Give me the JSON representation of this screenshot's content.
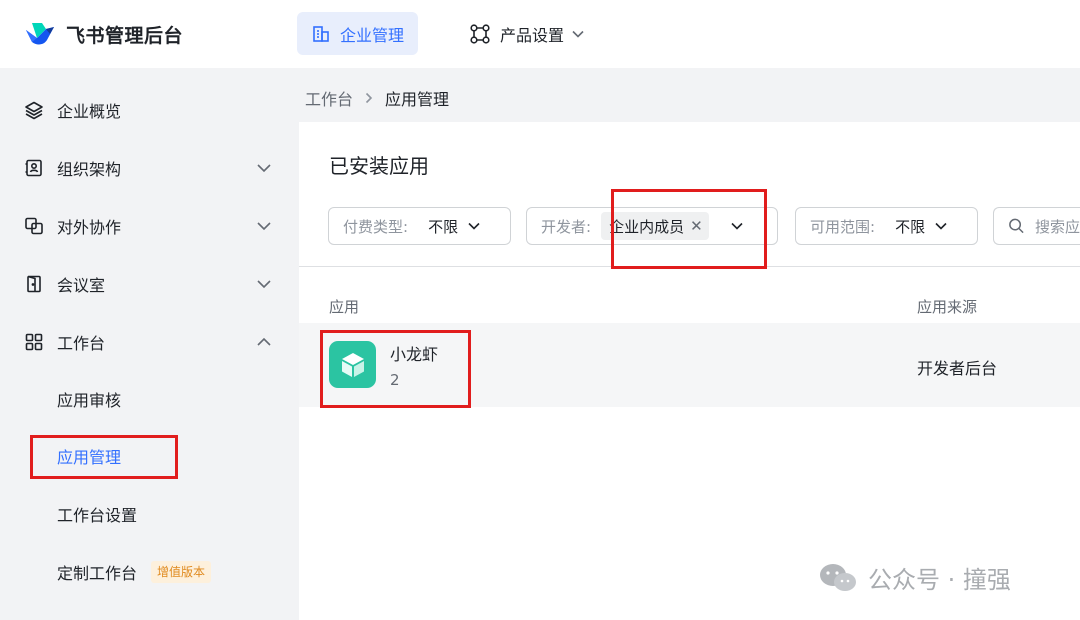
{
  "header": {
    "brand": "飞书管理后台",
    "nav": [
      {
        "label": "企业管理",
        "active": true
      },
      {
        "label": "产品设置",
        "active": false
      }
    ]
  },
  "sidebar": {
    "items": [
      {
        "label": "企业概览",
        "icon": "layers-icon"
      },
      {
        "label": "组织架构",
        "icon": "contacts-icon"
      },
      {
        "label": "对外协作",
        "icon": "collaboration-icon"
      },
      {
        "label": "会议室",
        "icon": "door-icon"
      },
      {
        "label": "工作台",
        "icon": "grid-icon"
      }
    ],
    "subitems": [
      {
        "label": "应用审核"
      },
      {
        "label": "应用管理",
        "active": true
      },
      {
        "label": "工作台设置"
      },
      {
        "label": "定制工作台",
        "badge": "增值版本"
      }
    ]
  },
  "breadcrumb": {
    "parent": "工作台",
    "current": "应用管理"
  },
  "main": {
    "title": "已安装应用",
    "filters": {
      "pay_type": {
        "label": "付费类型:",
        "value": "不限"
      },
      "developer": {
        "label": "开发者:",
        "tag": "企业内成员"
      },
      "scope": {
        "label": "可用范围:",
        "value": "不限"
      },
      "search_placeholder": "搜索应"
    },
    "table": {
      "headers": [
        "应用",
        "应用来源"
      ],
      "rows": [
        {
          "name": "小龙虾",
          "count": "2",
          "source": "开发者后台"
        }
      ]
    }
  },
  "watermark": {
    "text": "公众号 · 撞强"
  },
  "colors": {
    "accent": "#3370ff",
    "app_icon": "#2bc4a2",
    "highlight": "#e11d1d",
    "sidebar_bg": "#f2f3f5"
  }
}
